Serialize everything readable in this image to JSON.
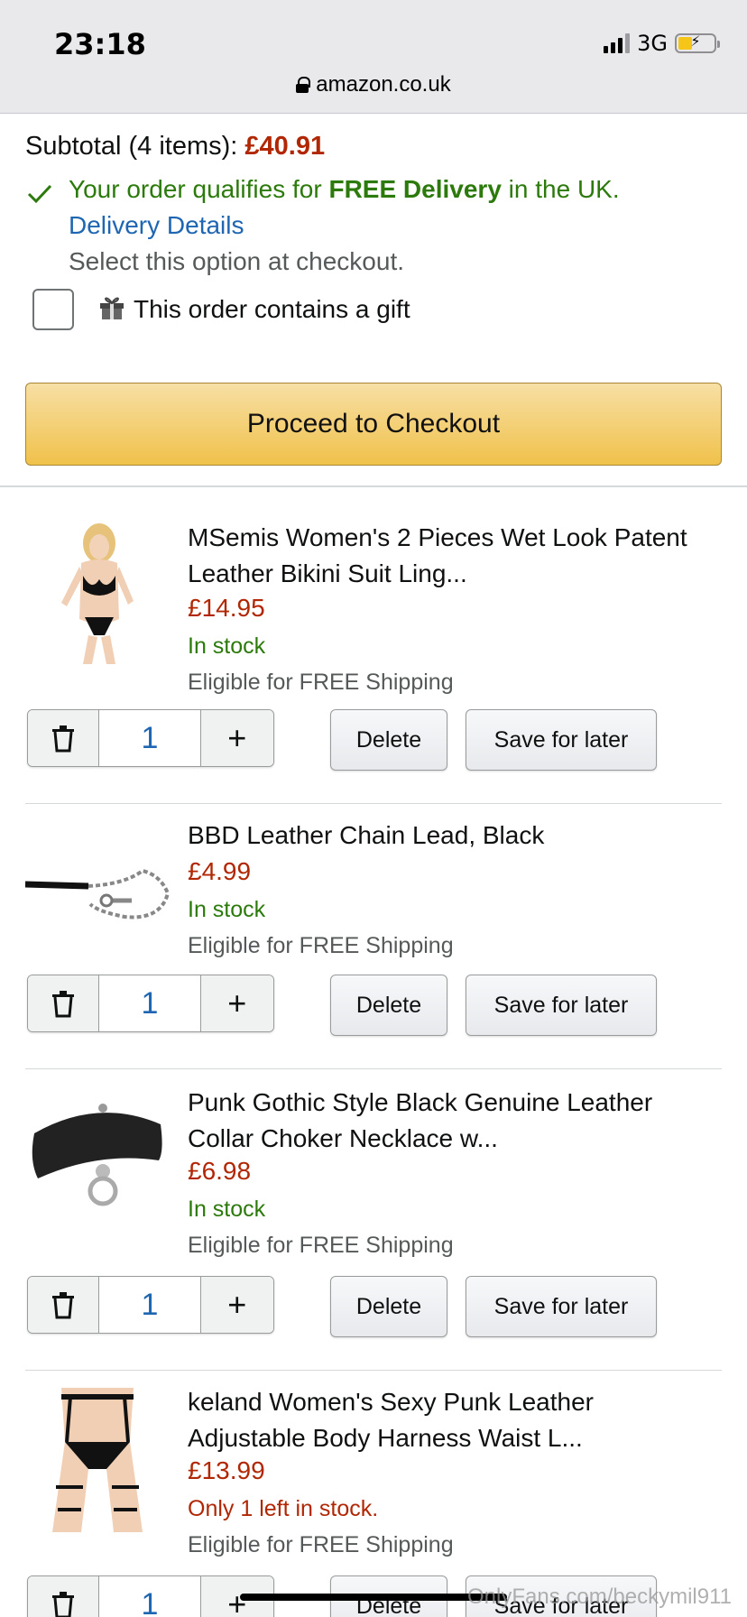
{
  "status_bar": {
    "time": "23:18",
    "network": "3G",
    "battery_level": 0.4
  },
  "url_bar": {
    "domain": "amazon.co.uk",
    "icon": "lock-icon"
  },
  "cart_summary": {
    "subtotal_label": "Subtotal (4 items):",
    "subtotal_value": "£40.91",
    "free_delivery_prefix": "Your order qualifies for ",
    "free_delivery_bold": "FREE Delivery",
    "free_delivery_suffix": " in the UK.",
    "delivery_details_link": "Delivery Details",
    "select_note": "Select this option at checkout.",
    "gift_label": "This order contains a gift",
    "gift_checked": false,
    "checkout_button": "Proceed to Checkout"
  },
  "items": [
    {
      "title_line1": "MSemis Women's 2 Pieces Wet Look Patent",
      "title_line2": "Leather Bikini Suit Ling...",
      "price": "£14.95",
      "stock": "In stock",
      "shipping": "Eligible for FREE Shipping",
      "quantity": "1",
      "delete_label": "Delete",
      "save_label": "Save for later",
      "image": "bikini-suit-product-image"
    },
    {
      "title_line1": "BBD Leather Chain Lead, Black",
      "title_line2": "",
      "price": "£4.99",
      "stock": "In stock",
      "shipping": "Eligible for FREE Shipping",
      "quantity": "1",
      "delete_label": "Delete",
      "save_label": "Save for later",
      "image": "chain-lead-product-image"
    },
    {
      "title_line1": "Punk Gothic Style Black Genuine Leather",
      "title_line2": "Collar Choker Necklace w...",
      "price": "£6.98",
      "stock": "In stock",
      "shipping": "Eligible for FREE Shipping",
      "quantity": "1",
      "delete_label": "Delete",
      "save_label": "Save for later",
      "image": "collar-choker-product-image"
    },
    {
      "title_line1": "keland Women's Sexy Punk Leather",
      "title_line2": "Adjustable Body Harness Waist L...",
      "price": "£13.99",
      "stock": "Only 1 left in stock.",
      "shipping": "Eligible for FREE Shipping",
      "quantity": "1",
      "delete_label": "Delete",
      "save_label": "Save for later",
      "image": "body-harness-product-image"
    }
  ],
  "watermark": "OnlyFans.com/beckymil911",
  "colors": {
    "price": "#b12704",
    "in_stock": "#2b7a0b",
    "link": "#1f66b2",
    "checkout_button": "#f0c14b"
  }
}
